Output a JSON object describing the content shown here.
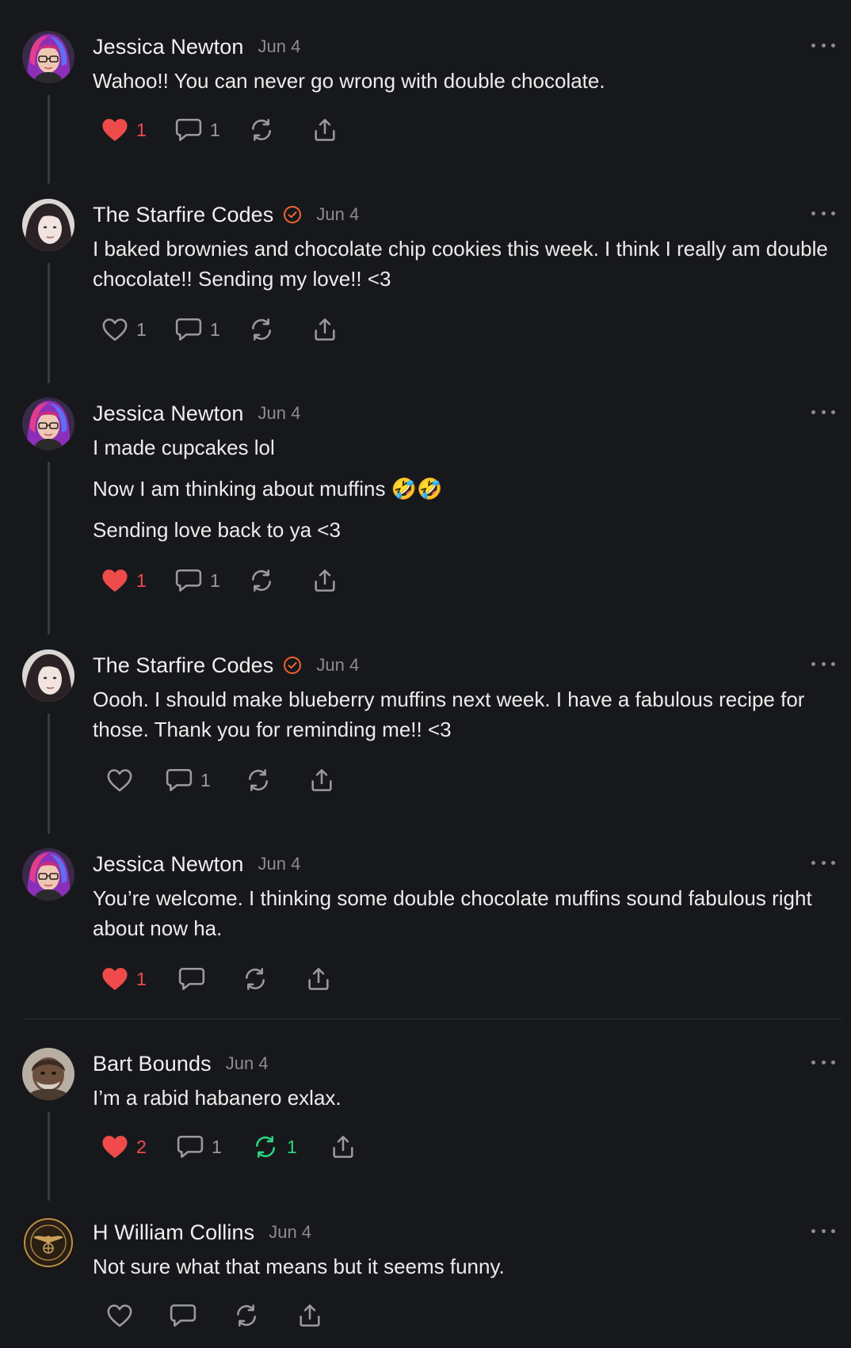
{
  "colors": {
    "background": "#17181b",
    "like_active": "#ef4b4b",
    "repost_active": "#2bd483",
    "verified_badge": "#f0652f",
    "muted": "#8c8c91"
  },
  "posts": [
    {
      "author": "Jessica Newton",
      "date": "Jun 4",
      "verified": false,
      "paragraphs": [
        "Wahoo!! You can never go wrong with double chocolate."
      ],
      "likes": "1",
      "liked": true,
      "replies": "1",
      "reposts": "",
      "reposted": false,
      "avatar": "jessica-avatar"
    },
    {
      "author": "The Starfire Codes",
      "date": "Jun 4",
      "verified": true,
      "paragraphs": [
        "I baked brownies and chocolate chip cookies this week. I think I really am double chocolate!! Sending my love!! <3"
      ],
      "likes": "1",
      "liked": false,
      "replies": "1",
      "reposts": "",
      "reposted": false,
      "avatar": "starfire-avatar"
    },
    {
      "author": "Jessica Newton",
      "date": "Jun 4",
      "verified": false,
      "paragraphs": [
        "I made cupcakes lol",
        "Now I am thinking about muffins 🤣🤣",
        "Sending love back to ya <3"
      ],
      "likes": "1",
      "liked": true,
      "replies": "1",
      "reposts": "",
      "reposted": false,
      "avatar": "jessica-avatar"
    },
    {
      "author": "The Starfire Codes",
      "date": "Jun 4",
      "verified": true,
      "paragraphs": [
        "Oooh. I should make blueberry muffins next week. I have a fabulous recipe for those. Thank you for reminding me!! <3"
      ],
      "likes": "",
      "liked": false,
      "replies": "1",
      "reposts": "",
      "reposted": false,
      "avatar": "starfire-avatar"
    },
    {
      "author": "Jessica Newton",
      "date": "Jun 4",
      "verified": false,
      "paragraphs": [
        "You’re welcome. I thinking some double chocolate muffins sound fabulous right about now ha."
      ],
      "likes": "1",
      "liked": true,
      "replies": "",
      "reposts": "",
      "reposted": false,
      "avatar": "jessica-avatar"
    },
    {
      "author": "Bart Bounds",
      "date": "Jun 4",
      "verified": false,
      "paragraphs": [
        "I’m a rabid habanero exlax."
      ],
      "likes": "2",
      "liked": true,
      "replies": "1",
      "reposts": "1",
      "reposted": true,
      "avatar": "bart-avatar"
    },
    {
      "author": "H William Collins",
      "date": "Jun 4",
      "verified": false,
      "paragraphs": [
        "Not sure what that means but it seems funny."
      ],
      "likes": "",
      "liked": false,
      "replies": "",
      "reposts": "",
      "reposted": false,
      "avatar": "emblem-avatar"
    }
  ]
}
